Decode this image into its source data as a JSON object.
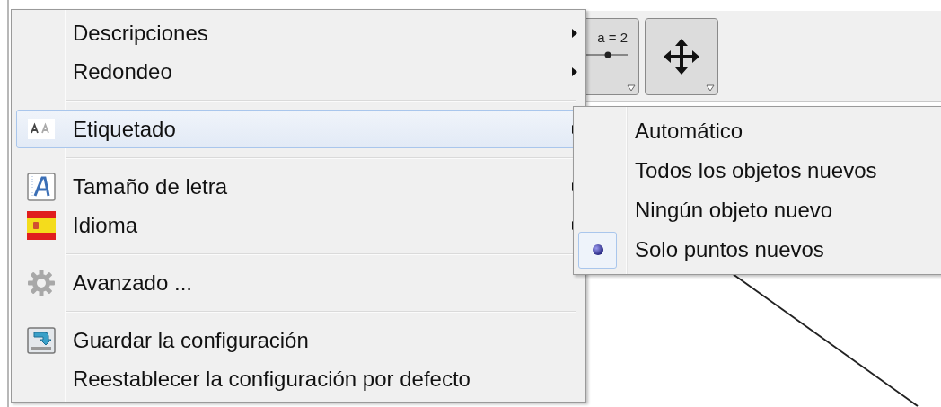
{
  "toolbar": {
    "tools": [
      {
        "kind": "slider",
        "label": "a = 2"
      },
      {
        "kind": "move"
      }
    ]
  },
  "menu": {
    "items": [
      {
        "kind": "plain",
        "label": "Descripciones",
        "has_submenu": true,
        "highlighted": false
      },
      {
        "kind": "plain",
        "label": "Redondeo",
        "has_submenu": true,
        "highlighted": false
      },
      {
        "kind": "separator"
      },
      {
        "kind": "labeling",
        "label": "Etiquetado",
        "has_submenu": true,
        "highlighted": true
      },
      {
        "kind": "separator"
      },
      {
        "kind": "font-size",
        "label": "Tamaño de letra",
        "has_submenu": true,
        "highlighted": false
      },
      {
        "kind": "language",
        "label": "Idioma",
        "has_submenu": true,
        "highlighted": false
      },
      {
        "kind": "separator"
      },
      {
        "kind": "settings",
        "label": "Avanzado ...",
        "has_submenu": false,
        "highlighted": false
      },
      {
        "kind": "separator"
      },
      {
        "kind": "save",
        "label": "Guardar la configuración",
        "has_submenu": false,
        "highlighted": false
      },
      {
        "kind": "plain",
        "label": "Reestablecer la configuración por defecto",
        "has_submenu": false,
        "highlighted": false
      }
    ]
  },
  "submenu": {
    "items": [
      {
        "label": "Automático",
        "selected": false
      },
      {
        "label": "Todos los objetos nuevos",
        "selected": false
      },
      {
        "label": "Ningún objeto nuevo",
        "selected": false
      },
      {
        "label": "Solo puntos nuevos",
        "selected": true
      }
    ]
  }
}
